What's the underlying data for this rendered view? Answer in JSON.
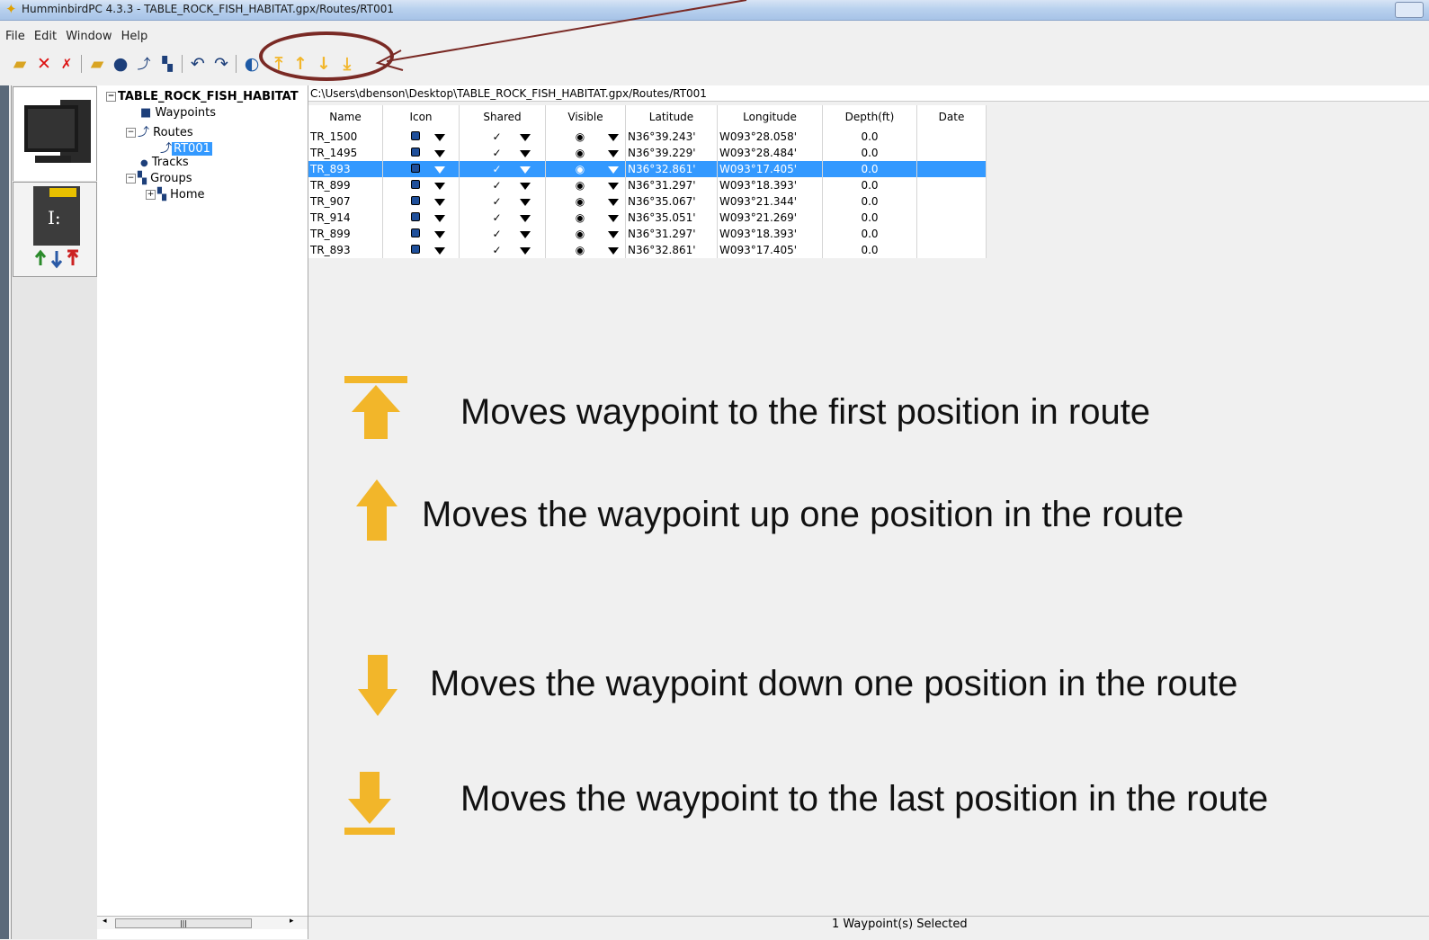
{
  "window": {
    "title": "HumminbirdPC 4.3.3 - TABLE_ROCK_FISH_HABITAT.gpx/Routes/RT001"
  },
  "menu": [
    "File",
    "Edit",
    "Window",
    "Help"
  ],
  "toolbar": {
    "icons": [
      "open-folder-icon",
      "delete-icon",
      "delete-all-icon",
      "new-folder-icon",
      "waypoint-icon",
      "route-icon",
      "group-icon",
      "undo-icon",
      "redo-icon",
      "globe-icon",
      "move-first-icon",
      "move-up-icon",
      "move-down-icon",
      "move-last-icon"
    ]
  },
  "devices": {
    "card_label": "I:"
  },
  "tree": {
    "root": "TABLE_ROCK_FISH_HABITAT",
    "waypoints": "Waypoints",
    "routes": "Routes",
    "rt001": "RT001",
    "tracks": "Tracks",
    "groups": "Groups",
    "home": "Home"
  },
  "path": "C:\\Users\\dbenson\\Desktop\\TABLE_ROCK_FISH_HABITAT.gpx/Routes/RT001",
  "grid": {
    "columns": [
      "Name",
      "Icon",
      "Shared",
      "Visible",
      "Latitude",
      "Longitude",
      "Depth(ft)",
      "Date"
    ],
    "rows": [
      {
        "name": "TR_1500",
        "lat": "N36°39.243'",
        "lon": "W093°28.058'",
        "depth": "0.0",
        "selected": false
      },
      {
        "name": "TR_1495",
        "lat": "N36°39.229'",
        "lon": "W093°28.484'",
        "depth": "0.0",
        "selected": false
      },
      {
        "name": "TR_893",
        "lat": "N36°32.861'",
        "lon": "W093°17.405'",
        "depth": "0.0",
        "selected": true
      },
      {
        "name": "TR_899",
        "lat": "N36°31.297'",
        "lon": "W093°18.393'",
        "depth": "0.0",
        "selected": false
      },
      {
        "name": "TR_907",
        "lat": "N36°35.067'",
        "lon": "W093°21.344'",
        "depth": "0.0",
        "selected": false
      },
      {
        "name": "TR_914",
        "lat": "N36°35.051'",
        "lon": "W093°21.269'",
        "depth": "0.0",
        "selected": false
      },
      {
        "name": "TR_899",
        "lat": "N36°31.297'",
        "lon": "W093°18.393'",
        "depth": "0.0",
        "selected": false
      },
      {
        "name": "TR_893",
        "lat": "N36°32.861'",
        "lon": "W093°17.405'",
        "depth": "0.0",
        "selected": false
      }
    ]
  },
  "descriptions": {
    "first": "Moves waypoint to the first position in route",
    "up": "Moves the waypoint up one position in the route",
    "down": "Moves the waypoint down one position in the route",
    "last": "Moves the waypoint to the last position in the route"
  },
  "status": "1 Waypoint(s) Selected",
  "colors": {
    "selection": "#3399ff",
    "annotation": "#7a2a25",
    "arrow_gold": "#f2b62a"
  }
}
